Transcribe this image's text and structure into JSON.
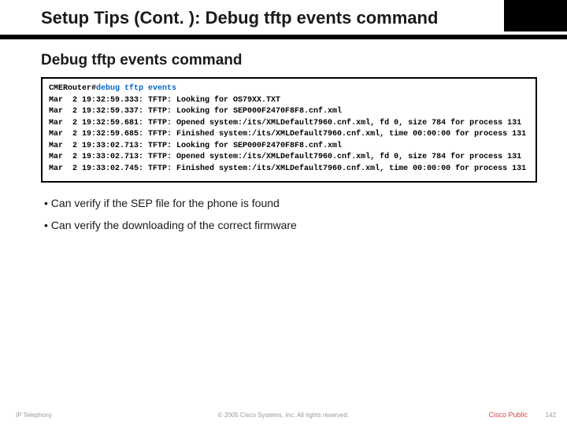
{
  "slide": {
    "title": "Setup Tips (Cont. ): Debug tftp events command",
    "subtitle": "Debug tftp events command"
  },
  "terminal": {
    "prompt": "CMERouter#",
    "command": "debug tftp events",
    "lines": [
      "Mar  2 19:32:59.333: TFTP: Looking for OS79XX.TXT",
      "Mar  2 19:32:59.337: TFTP: Looking for SEP000F2470F8F8.cnf.xml",
      "Mar  2 19:32:59.681: TFTP: Opened system:/its/XMLDefault7960.cnf.xml, fd 0, size 784 for process 131",
      "Mar  2 19:32:59.685: TFTP: Finished system:/its/XMLDefault7960.cnf.xml, time 00:00:00 for process 131",
      "Mar  2 19:33:02.713: TFTP: Looking for SEP000F2470F8F8.cnf.xml",
      "Mar  2 19:33:02.713: TFTP: Opened system:/its/XMLDefault7960.cnf.xml, fd 0, size 784 for process 131",
      "Mar  2 19:33:02.745: TFTP: Finished system:/its/XMLDefault7960.cnf.xml, time 00:00:00 for process 131"
    ]
  },
  "bullets": {
    "b1": "Can verify if the SEP file for the phone is found",
    "b2": "Can verify the downloading of the correct firmware"
  },
  "footer": {
    "left": "IP Telephony",
    "center": "© 2005 Cisco Systems, Inc. All rights reserved.",
    "right1": "Cisco Public",
    "right2": "142"
  }
}
